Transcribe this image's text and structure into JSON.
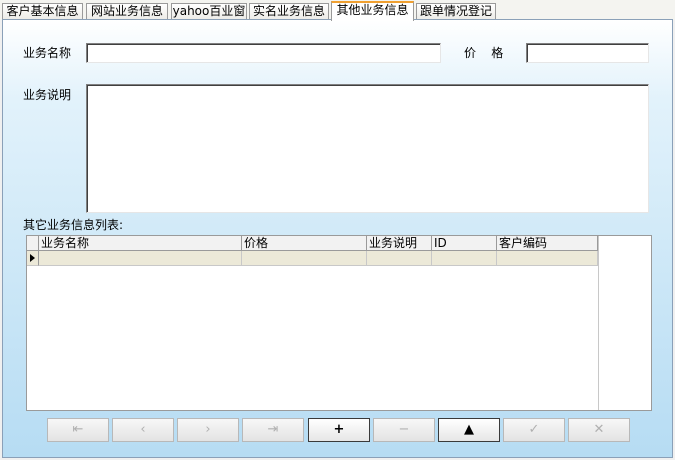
{
  "tabs": [
    {
      "label": "客户基本信息"
    },
    {
      "label": "网站业务信息"
    },
    {
      "label": "yahoo百业窗"
    },
    {
      "label": "实名业务信息"
    },
    {
      "label": "其他业务信息"
    },
    {
      "label": "跟单情况登记"
    }
  ],
  "active_tab": "其他业务信息",
  "form": {
    "name_label": "业务名称",
    "name_value": "",
    "price_label": "价    格",
    "price_value": "",
    "desc_label": "业务说明",
    "desc_value": ""
  },
  "list": {
    "title": "其它业务信息列表:",
    "columns": [
      "业务名称",
      "价格",
      "业务说明",
      "ID",
      "客户编码"
    ],
    "rows": [
      [
        "",
        "",
        "",
        "",
        ""
      ]
    ]
  },
  "navigator": {
    "first_icon": "⇤",
    "prior_icon": "‹",
    "next_icon": "›",
    "last_icon": "⇥",
    "insert_icon": "+",
    "delete_icon": "−",
    "edit_icon": "▲",
    "post_icon": "✓",
    "cancel_icon": "✕"
  }
}
